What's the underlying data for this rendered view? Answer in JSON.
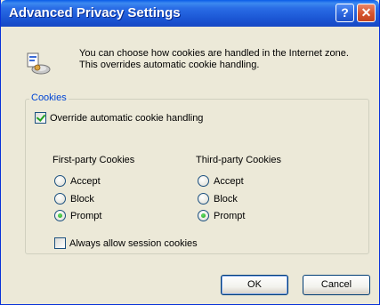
{
  "window": {
    "title": "Advanced Privacy Settings",
    "help_glyph": "?",
    "close_glyph": "✕"
  },
  "intro": {
    "text": "You can choose how cookies are handled in the Internet zone.  This overrides automatic cookie handling."
  },
  "cookies": {
    "group_label": "Cookies",
    "override_label": "Override automatic cookie handling",
    "override_checked": true,
    "first_party": {
      "label": "First-party Cookies",
      "options": [
        "Accept",
        "Block",
        "Prompt"
      ],
      "selected": "Prompt"
    },
    "third_party": {
      "label": "Third-party Cookies",
      "options": [
        "Accept",
        "Block",
        "Prompt"
      ],
      "selected": "Prompt"
    },
    "session_label": "Always allow session cookies",
    "session_checked": false
  },
  "buttons": {
    "ok": "OK",
    "cancel": "Cancel"
  },
  "colors": {
    "titlebar": "#2a6de6",
    "group_label": "#0046d5",
    "dialog_bg": "#ece9d8"
  },
  "icons": {
    "info": "cookie-settings-icon",
    "help": "help-icon",
    "close": "close-icon"
  }
}
